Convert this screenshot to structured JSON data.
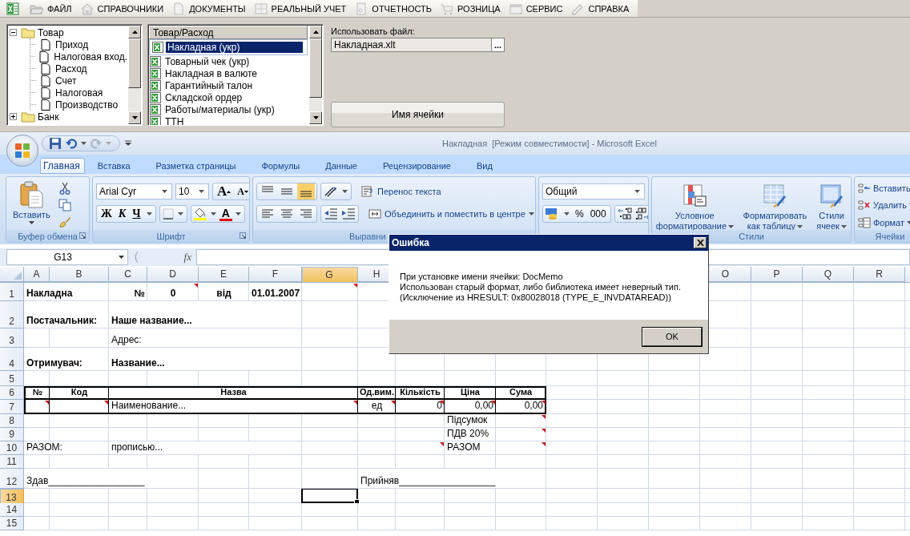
{
  "menu": [
    {
      "label": "ФАЙЛ"
    },
    {
      "label": "СПРАВОЧНИКИ"
    },
    {
      "label": "ДОКУМЕНТЫ"
    },
    {
      "label": "РЕАЛЬНЫЙ УЧЕТ"
    },
    {
      "label": "ОТЧЕТНОСТЬ"
    },
    {
      "label": "РОЗНИЦА"
    },
    {
      "label": "СЕРВИС"
    },
    {
      "label": "СПРАВКА"
    }
  ],
  "tree": [
    {
      "label": "Товар",
      "kind": "folder",
      "expanded": true,
      "children": [
        {
          "label": "Приход",
          "kind": "document"
        },
        {
          "label": "Налоговая вход.",
          "kind": "document"
        },
        {
          "label": "Расход",
          "kind": "document"
        },
        {
          "label": "Счет",
          "kind": "document"
        },
        {
          "label": "Налоговая",
          "kind": "document"
        },
        {
          "label": "Производство",
          "kind": "document"
        }
      ]
    },
    {
      "label": "Банк",
      "kind": "folder",
      "expanded": false
    }
  ],
  "template_list": {
    "header": "Товар/Расход",
    "items": [
      {
        "label": "Накладная (укр)",
        "selected": true
      },
      {
        "label": "Товарный чек (укр)",
        "selected": false
      },
      {
        "label": "Накладная в валюте",
        "selected": false
      },
      {
        "label": "Гарантийный талон",
        "selected": false
      },
      {
        "label": "Складской ордер",
        "selected": false
      },
      {
        "label": "Работы/материалы (укр)",
        "selected": false
      },
      {
        "label": "ТТН",
        "selected": false
      }
    ]
  },
  "file_panel": {
    "label": "Использовать файл:",
    "value": "Накладная.xlt",
    "browse": "...",
    "button": "Имя ячейки"
  },
  "excel": {
    "title": "Накладная  [Режим совместимости] - Microsoft Excel",
    "tabs": [
      {
        "label": "Главная",
        "selected": true
      },
      {
        "label": "Вставка",
        "selected": false
      },
      {
        "label": "Разметка страницы",
        "selected": false
      },
      {
        "label": "Формулы",
        "selected": false
      },
      {
        "label": "Данные",
        "selected": false
      },
      {
        "label": "Рецензирование",
        "selected": false
      },
      {
        "label": "Вид",
        "selected": false
      }
    ],
    "groups": [
      {
        "kind": "clipboard",
        "label": "Буфер обмена",
        "paste": "Вставить"
      },
      {
        "kind": "font",
        "label": "Шрифт",
        "font": "Arial Cyr",
        "size": "10",
        "grow": "A",
        "shrink": "A",
        "bold": "Ж",
        "italic": "К",
        "underline": "Ч",
        "font_color": "A"
      },
      {
        "kind": "alignment",
        "label": "Выравни",
        "valign": [
          {
            "selected": false
          },
          {
            "selected": false
          },
          {
            "selected": true
          }
        ],
        "wrap": "Перенос текста",
        "merge": "Объединить и поместить в центре"
      },
      {
        "kind": "number",
        "format": "Общий",
        "percent": "%",
        "thousands": "000"
      },
      {
        "kind": "styles",
        "label": "Стили",
        "items": [
          "Условное форматирование",
          "Форматировать как таблицу",
          "Стили ячеек"
        ]
      },
      {
        "kind": "cells",
        "label": "Ячейки",
        "items": [
          "Вставить",
          "Удалить",
          "Формат"
        ]
      }
    ],
    "name_box": "G13",
    "function_label": "fx"
  },
  "sheet": {
    "columns_left": [
      {
        "label": "A",
        "selected": false
      },
      {
        "label": "B",
        "selected": false
      },
      {
        "label": "C",
        "selected": false
      },
      {
        "label": "D",
        "selected": false
      },
      {
        "label": "E",
        "selected": false
      },
      {
        "label": "F",
        "selected": false
      },
      {
        "label": "G",
        "selected": true
      },
      {
        "label": "H",
        "selected": false
      }
    ],
    "columns_right": [
      {
        "label": "O",
        "selected": false
      },
      {
        "label": "P",
        "selected": false
      },
      {
        "label": "Q",
        "selected": false
      },
      {
        "label": "R",
        "selected": false
      }
    ],
    "rows": [
      {
        "number": "1",
        "selected": false,
        "kind": "plain",
        "cells": {
          "A": {
            "text": "Накладна",
            "bold": true,
            "centered": false,
            "right_aligned": false,
            "comment": false,
            "selected": false
          },
          "C": {
            "text": "№",
            "bold": true,
            "centered": false,
            "right_aligned": true,
            "comment": false,
            "selected": false
          },
          "D": {
            "text": "0",
            "bold": true,
            "centered": true,
            "comment": true,
            "selected": false
          },
          "E": {
            "text": "від",
            "bold": true,
            "centered": true,
            "comment": false,
            "selected": false
          },
          "F": {
            "text": "01.01.2007",
            "bold": true,
            "centered": false,
            "right_aligned": false,
            "comment": false,
            "selected": false
          },
          "G": {
            "comment": true,
            "selected": false
          }
        }
      },
      {
        "number": "2",
        "selected": false,
        "kind": "plain",
        "cells": {
          "A": {
            "text": "Постачальник:",
            "bold": true,
            "centered": false,
            "right_aligned": false,
            "comment": false,
            "selected": false
          },
          "C": {
            "text": "Наше название...",
            "bold": true,
            "centered": false,
            "right_aligned": false,
            "comment": false,
            "selected": false
          }
        }
      },
      {
        "number": "3",
        "selected": false,
        "kind": "plain",
        "cells": {
          "C": {
            "text": "Адрес:",
            "bold": false,
            "centered": false,
            "right_aligned": false,
            "comment": false,
            "selected": false
          }
        }
      },
      {
        "number": "4",
        "selected": false,
        "kind": "plain",
        "cells": {
          "A": {
            "text": "Отримувач:",
            "bold": true,
            "centered": false,
            "right_aligned": false,
            "comment": false,
            "selected": false
          },
          "C": {
            "text": "Название...",
            "bold": true,
            "centered": false,
            "right_aligned": false,
            "comment": false,
            "selected": false
          }
        }
      },
      {
        "number": "5",
        "selected": false
      },
      {
        "number": "6",
        "selected": false,
        "kind": "table-head",
        "cells": {
          "A": {
            "text": "№",
            "bold": true,
            "centered": true,
            "comment": false,
            "selected": false
          },
          "B": {
            "text": "Код",
            "bold": true,
            "centered": true,
            "comment": false,
            "selected": false
          },
          "C": {
            "text": "Назва",
            "bold": true,
            "centered": true,
            "comment": false,
            "selected": false
          },
          "H": {
            "text": "Од.вим.",
            "bold": true,
            "centered": true,
            "comment": false,
            "selected": false
          },
          "I": {
            "text": "Кількість",
            "bold": true,
            "centered": true,
            "comment": false,
            "selected": false
          },
          "J": {
            "text": "Ціна",
            "bold": true,
            "centered": true,
            "comment": false,
            "selected": false
          },
          "K": {
            "text": "Сума",
            "bold": true,
            "centered": true,
            "comment": false,
            "selected": false
          }
        }
      },
      {
        "number": "7",
        "selected": false,
        "kind": "table-body",
        "cells": {
          "A": {
            "comment": true,
            "selected": false
          },
          "B": {
            "comment": true,
            "selected": false
          },
          "C": {
            "text": "Наименование...",
            "bold": false,
            "centered": false,
            "right_aligned": false,
            "comment": true,
            "selected": false
          },
          "H": {
            "text": "ед",
            "bold": false,
            "centered": true,
            "comment": true,
            "selected": false
          },
          "I": {
            "text": "0",
            "bold": false,
            "centered": false,
            "right_aligned": true,
            "comment": true,
            "selected": false
          },
          "J": {
            "text": "0,00",
            "bold": false,
            "centered": false,
            "right_aligned": true,
            "comment": true,
            "selected": false
          },
          "K": {
            "text": "0,00",
            "bold": false,
            "centered": false,
            "right_aligned": true,
            "comment": true,
            "selected": false
          }
        }
      },
      {
        "number": "8",
        "selected": false,
        "kind": "plain",
        "cells": {
          "J": {
            "text": "Підсумок",
            "bold": false,
            "centered": false,
            "right_aligned": false,
            "comment": false,
            "selected": false
          },
          "K": {
            "comment": true,
            "selected": false
          }
        }
      },
      {
        "number": "9",
        "selected": false,
        "kind": "plain",
        "cells": {
          "J": {
            "text": "ПДВ 20%",
            "bold": false,
            "centered": false,
            "right_aligned": false,
            "comment": false,
            "selected": false
          },
          "K": {
            "comment": true,
            "selected": false
          }
        }
      },
      {
        "number": "10",
        "selected": false,
        "kind": "plain",
        "cells": {
          "A": {
            "text": "РАЗОМ:",
            "bold": false,
            "centered": false,
            "right_aligned": false,
            "comment": false,
            "selected": false
          },
          "C": {
            "text": "прописью...",
            "bold": false,
            "centered": false,
            "right_aligned": false,
            "comment": false,
            "selected": false
          },
          "I": {
            "comment": true,
            "selected": false
          },
          "J": {
            "text": "РАЗОМ",
            "bold": false,
            "centered": false,
            "right_aligned": false,
            "comment": false,
            "selected": false
          },
          "K": {
            "comment": true,
            "selected": false
          }
        }
      },
      {
        "number": "11",
        "selected": false
      },
      {
        "number": "12",
        "selected": false,
        "kind": "plain",
        "cells": {
          "A": {
            "text": "Здав__________________",
            "bold": false,
            "centered": false,
            "right_aligned": false,
            "comment": false,
            "selected": false
          },
          "H": {
            "text": "Прийняв__________________",
            "bold": false,
            "centered": false,
            "right_aligned": false,
            "comment": false,
            "selected": false
          }
        }
      },
      {
        "number": "13",
        "selected": true,
        "kind": "plain",
        "cells": {
          "G": {
            "comment": false,
            "selected": true
          }
        }
      },
      {
        "number": "14",
        "selected": false
      },
      {
        "number": "15",
        "selected": false
      }
    ]
  },
  "dialog": {
    "title": "Ошибка",
    "lines": [
      "При установке имени ячейки: DocMemo",
      "Использован старый формат, либо библиотека имеет неверный тип.",
      "(Исключение из HRESULT: 0x80028018 (TYPE_E_INVDATAREAD))"
    ],
    "ok": "OK"
  }
}
